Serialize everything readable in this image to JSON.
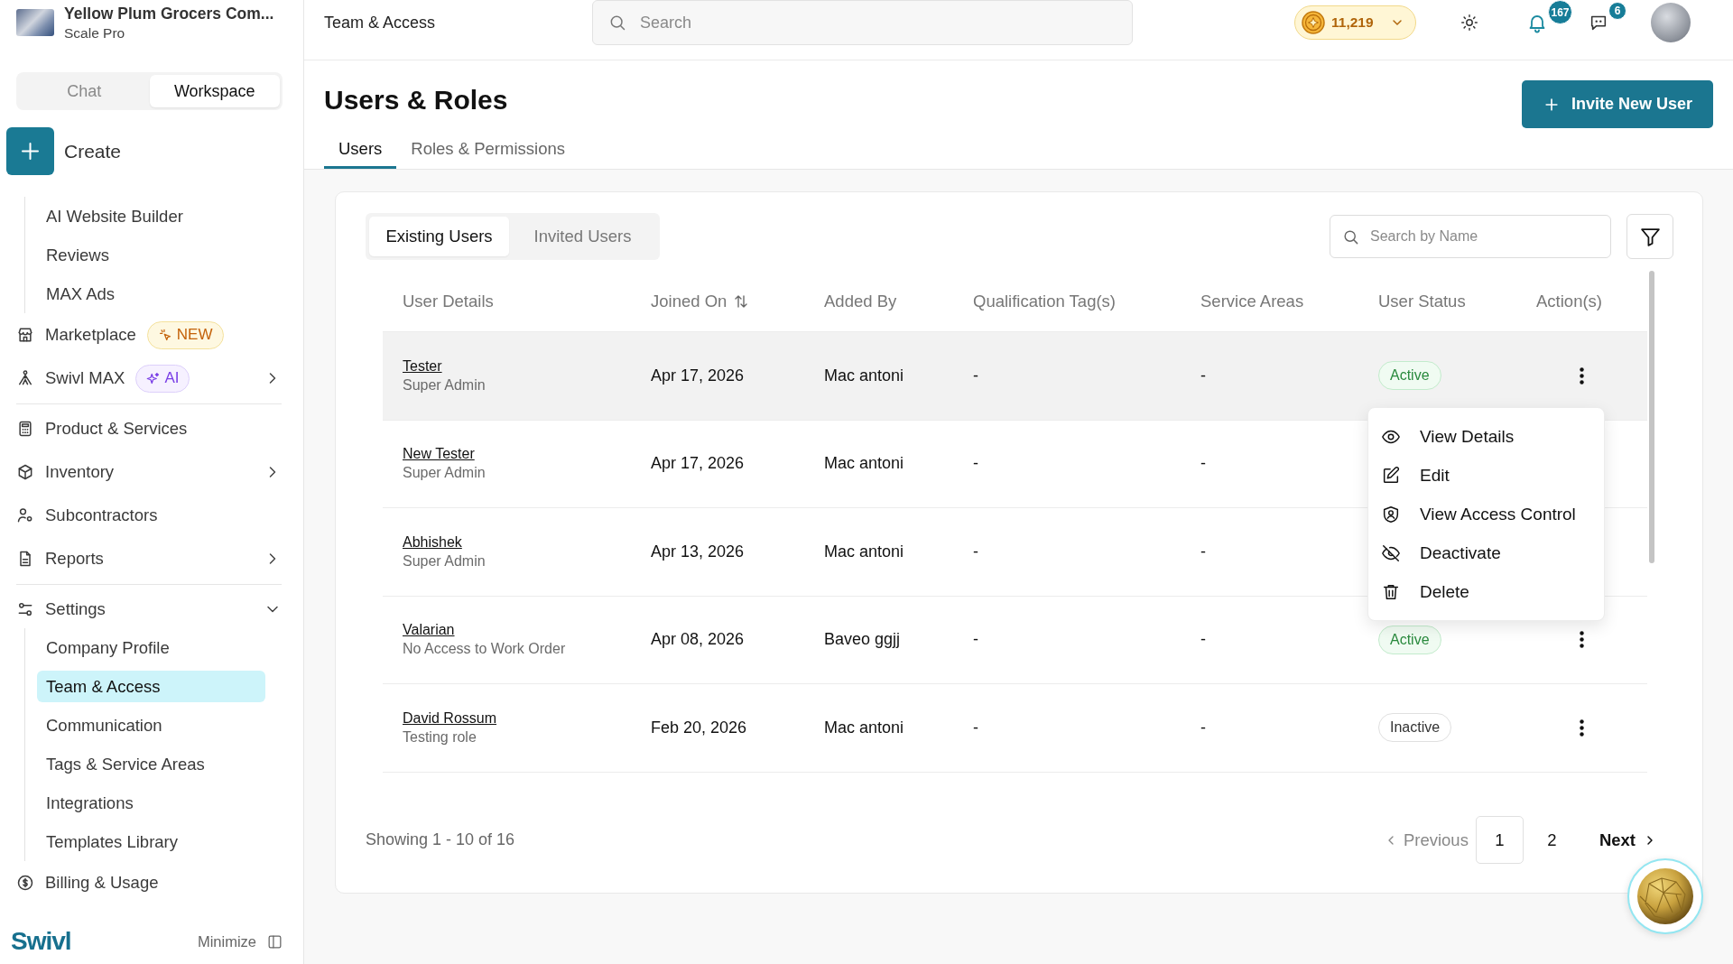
{
  "sidebar": {
    "company": {
      "name": "Yellow Plum Grocers Com...",
      "plan": "Scale Pro"
    },
    "mode_tabs": [
      {
        "label": "Chat",
        "selected": false
      },
      {
        "label": "Workspace",
        "selected": true
      }
    ],
    "create_label": "Create",
    "nav_sections": [
      {
        "items": [
          {
            "kind": "sublist",
            "children": [
              {
                "label": "AI Website Builder",
                "selected": false
              },
              {
                "label": "Reviews",
                "selected": false
              },
              {
                "label": "MAX Ads",
                "selected": false
              }
            ]
          },
          {
            "kind": "link",
            "label": "Marketplace",
            "badge": {
              "kind": "new",
              "text": "NEW"
            }
          },
          {
            "kind": "link",
            "label": "Swivl MAX",
            "badge": {
              "kind": "ai",
              "text": "AI"
            },
            "expanded": false
          }
        ]
      },
      {
        "items": [
          {
            "kind": "link",
            "label": "Product & Services"
          },
          {
            "kind": "link",
            "label": "Inventory",
            "expanded": false
          },
          {
            "kind": "link",
            "label": "Subcontractors"
          },
          {
            "kind": "link",
            "label": "Reports",
            "expanded": false
          }
        ]
      },
      {
        "items": [
          {
            "kind": "link",
            "label": "Settings",
            "expanded": true,
            "children": [
              {
                "label": "Company Profile",
                "selected": false
              },
              {
                "label": "Team & Access",
                "selected": true
              },
              {
                "label": "Communication",
                "selected": false
              },
              {
                "label": "Tags & Service Areas",
                "selected": false
              },
              {
                "label": "Integrations",
                "selected": false
              },
              {
                "label": "Templates Library",
                "selected": false
              }
            ]
          },
          {
            "kind": "link",
            "label": "Billing & Usage"
          }
        ]
      }
    ],
    "footer": {
      "logo": "Swivl",
      "minimize": "Minimize"
    }
  },
  "top_bar": {
    "breadcrumb": "Team & Access",
    "search": {
      "placeholder": "Search"
    },
    "credits": "11,219",
    "notification_count": "167",
    "message_count": "6"
  },
  "page": {
    "title": "Users & Roles",
    "invite_button": "Invite New User",
    "tabs": [
      {
        "label": "Users",
        "selected": true
      },
      {
        "label": "Roles & Permissions",
        "selected": false
      }
    ]
  },
  "users_panel": {
    "user_tabs": [
      {
        "label": "Existing Users",
        "selected": true
      },
      {
        "label": "Invited Users",
        "selected": false
      }
    ],
    "search": {
      "placeholder": "Search by Name"
    },
    "table": {
      "columns": [
        {
          "label": "User Details",
          "sortable": false
        },
        {
          "label": "Joined On",
          "sortable": true
        },
        {
          "label": "Added By",
          "sortable": false
        },
        {
          "label": "Qualification Tag(s)",
          "sortable": false
        },
        {
          "label": "Service Areas",
          "sortable": false
        },
        {
          "label": "User Status",
          "sortable": false
        },
        {
          "label": "Action(s)",
          "sortable": false
        }
      ],
      "rows": [
        {
          "name": "Tester",
          "role": "Super Admin",
          "joined_on": "Apr 17, 2026",
          "added_by": "Mac antoni",
          "qualification_tags": "-",
          "service_areas": "-",
          "status": {
            "kind": "active",
            "text": "Active"
          },
          "selected": true
        },
        {
          "name": "New Tester",
          "role": "Super Admin",
          "joined_on": "Apr 17, 2026",
          "added_by": "Mac antoni",
          "qualification_tags": "-",
          "service_areas": "-",
          "selected": false
        },
        {
          "name": "Abhishek",
          "role": "Super Admin",
          "joined_on": "Apr 13, 2026",
          "added_by": "Mac antoni",
          "qualification_tags": "-",
          "service_areas": "-",
          "selected": false
        },
        {
          "name": "Valarian",
          "role": "No Access to Work Order",
          "joined_on": "Apr 08, 2026",
          "added_by": "Baveo ggjj",
          "qualification_tags": "-",
          "service_areas": "-",
          "status": {
            "kind": "active",
            "text": "Active"
          },
          "selected": false
        },
        {
          "name": "David Rossum",
          "role": "Testing role",
          "joined_on": "Feb 20, 2026",
          "added_by": "Mac antoni",
          "qualification_tags": "-",
          "service_areas": "-",
          "status": {
            "kind": "inactive",
            "text": "Inactive"
          },
          "selected": false
        }
      ]
    },
    "row_menu": {
      "items": [
        {
          "label": "View Details"
        },
        {
          "label": "Edit"
        },
        {
          "label": "View Access Control"
        },
        {
          "label": "Deactivate"
        },
        {
          "label": "Delete"
        }
      ]
    },
    "pagination": {
      "summary": "Showing 1 - 10 of 16",
      "previous": "Previous",
      "pages": [
        {
          "label": "1",
          "selected": true
        },
        {
          "label": "2",
          "selected": false
        }
      ],
      "next": "Next"
    }
  }
}
